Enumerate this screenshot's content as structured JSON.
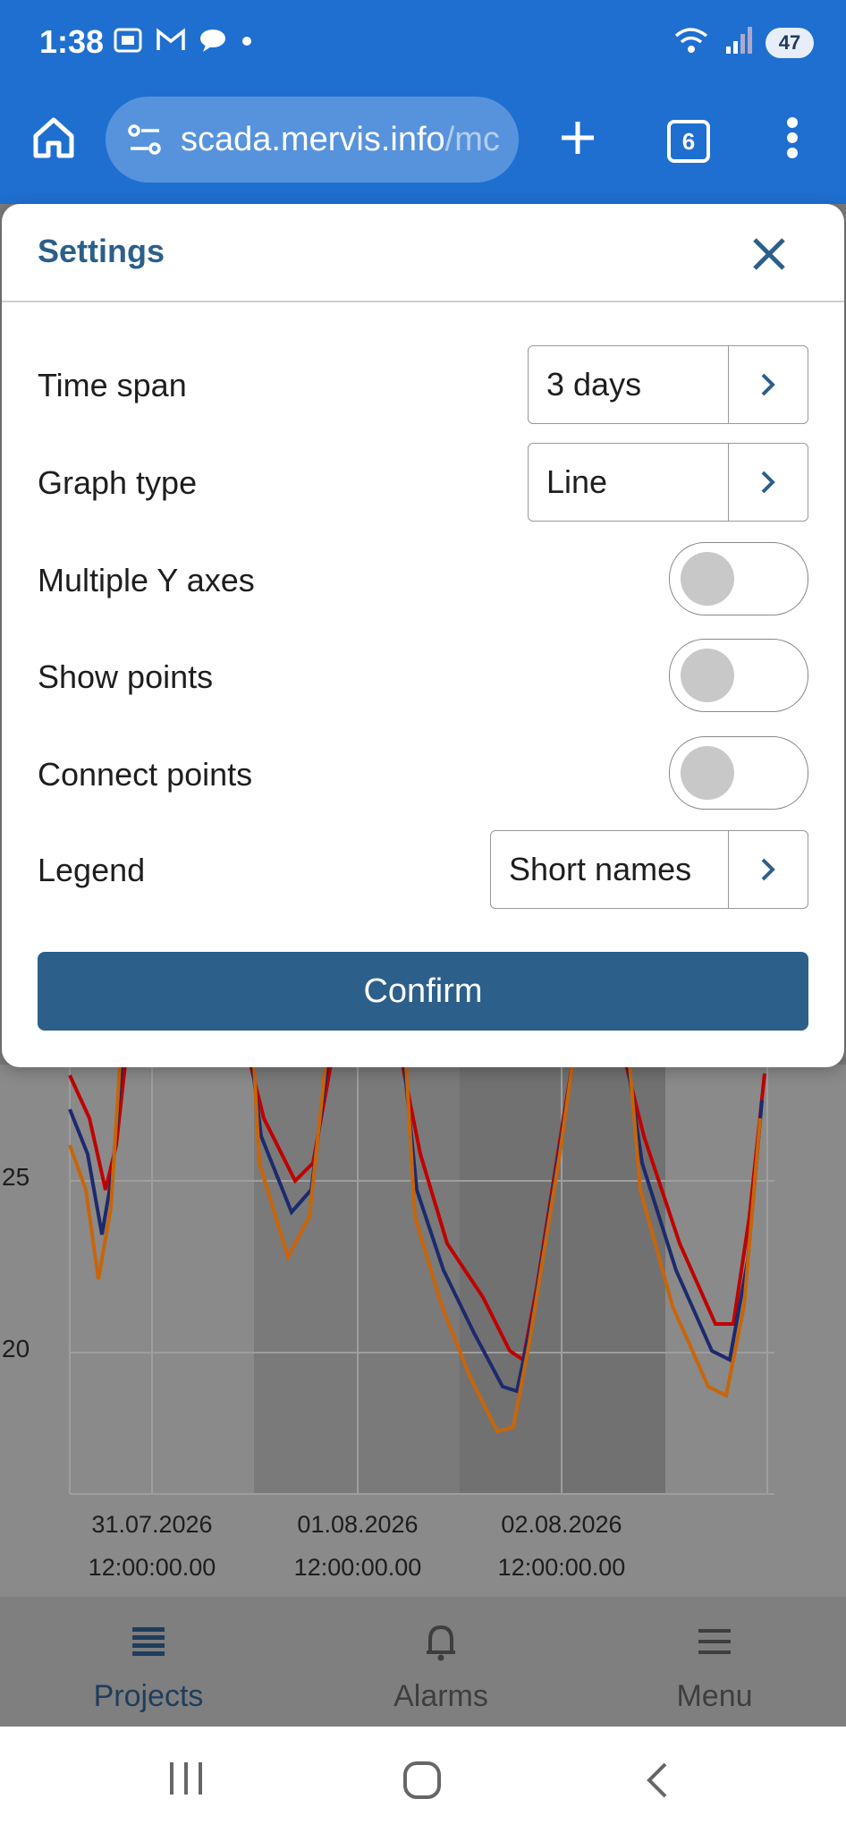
{
  "status_bar": {
    "time": "1:38",
    "notification_icons": [
      "screenshot-icon",
      "gmail-icon",
      "chat-icon",
      "dot-icon"
    ],
    "battery": "47"
  },
  "browser": {
    "url_main": "scada.mervis.info",
    "url_rest": "/mc",
    "tab_count": "6"
  },
  "settings": {
    "title": "Settings",
    "rows": [
      {
        "label": "Time span",
        "value": "3 days"
      },
      {
        "label": "Graph type",
        "value": "Line"
      },
      {
        "label": "Multiple Y axes",
        "state": "off"
      },
      {
        "label": "Show points",
        "state": "off"
      },
      {
        "label": "Connect points",
        "state": "off"
      },
      {
        "label": "Legend",
        "value": "Short names"
      }
    ],
    "confirm_label": "Confirm"
  },
  "chart": {
    "y_ticks": [
      "25",
      "20"
    ],
    "x_ticks": [
      {
        "date": "31.07.2026",
        "time": "12:00:00.00"
      },
      {
        "date": "01.08.2026",
        "time": "12:00:00.00"
      },
      {
        "date": "02.08.2026",
        "time": "12:00:00.00"
      }
    ],
    "series_colors": [
      "#c00000",
      "#1c2a6e",
      "#c8650a"
    ]
  },
  "bottom_nav": {
    "items": [
      {
        "label": "Projects",
        "icon": "list-icon",
        "active": true
      },
      {
        "label": "Alarms",
        "icon": "bell-icon",
        "active": false
      },
      {
        "label": "Menu",
        "icon": "menu-icon",
        "active": false
      }
    ]
  },
  "colors": {
    "browser_bar": "#1f6fd1",
    "accent": "#2c5f8a"
  }
}
